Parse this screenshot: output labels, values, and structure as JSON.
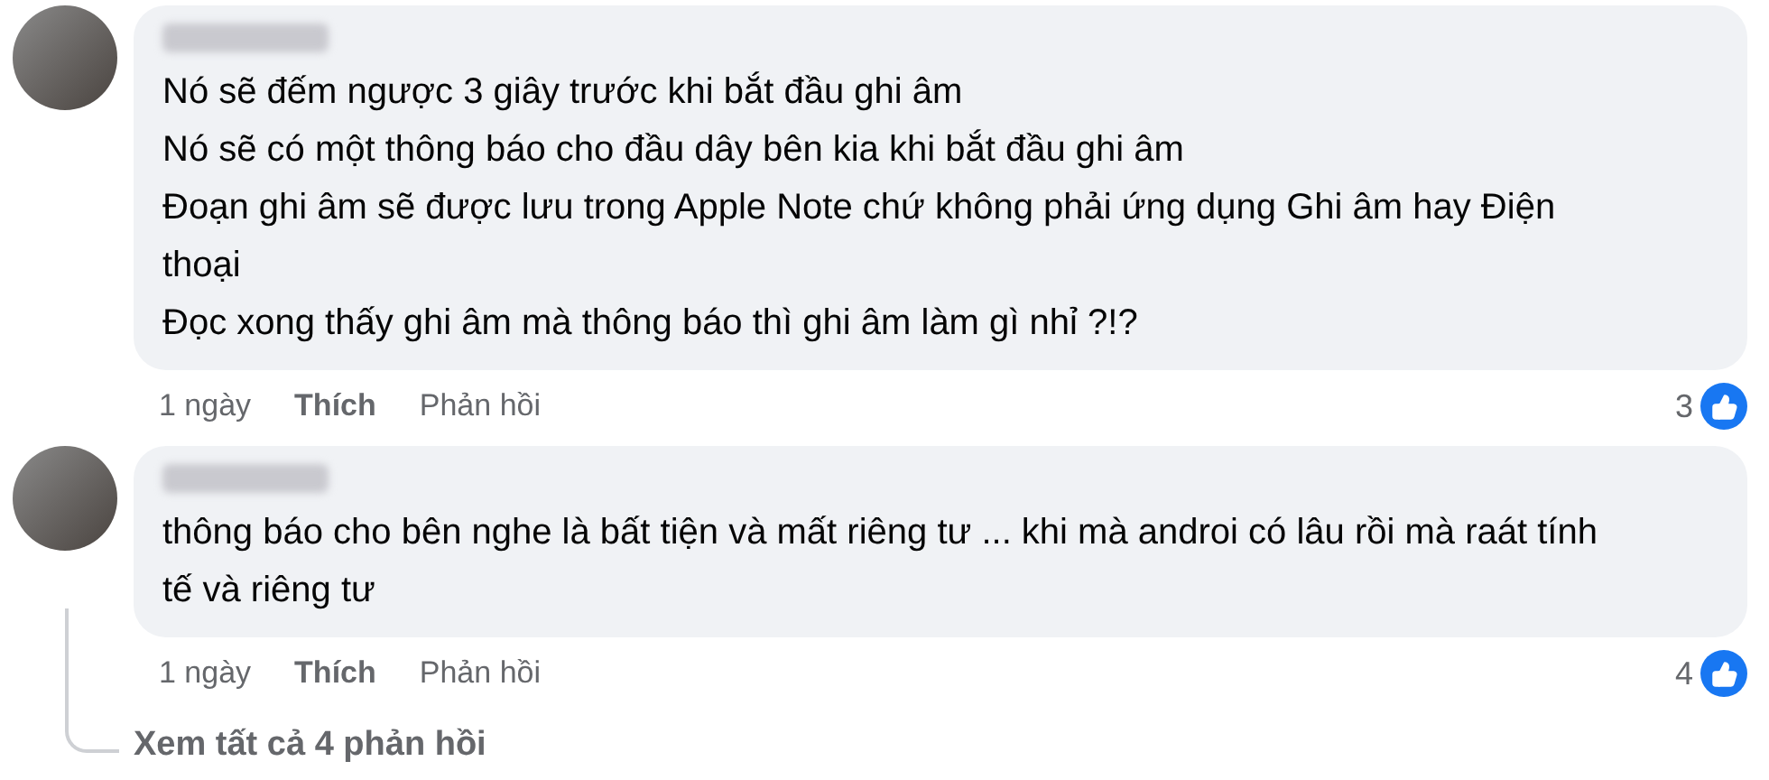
{
  "comments": [
    {
      "lines": [
        "Nó sẽ đếm ngược 3 giây trước khi bắt đầu ghi âm",
        "Nó sẽ có một thông báo cho đầu dây bên kia khi bắt đầu ghi âm",
        "Đoạn ghi âm sẽ được lưu trong Apple Note chứ không phải ứng dụng Ghi âm hay Điện thoại",
        "Đọc xong thấy ghi âm mà thông báo thì ghi âm làm gì nhỉ ?!?"
      ],
      "time": "1 ngày",
      "like": "Thích",
      "reply": "Phản hồi",
      "reactions": "3"
    },
    {
      "lines": [
        "thông báo cho bên nghe là bất tiện và mất riêng tư ... khi mà androi có lâu rồi mà raát tính tế và riêng tư"
      ],
      "time": "1 ngày",
      "like": "Thích",
      "reply": "Phản hồi",
      "reactions": "4"
    }
  ],
  "view_replies": "Xem tất cả 4 phản hồi"
}
